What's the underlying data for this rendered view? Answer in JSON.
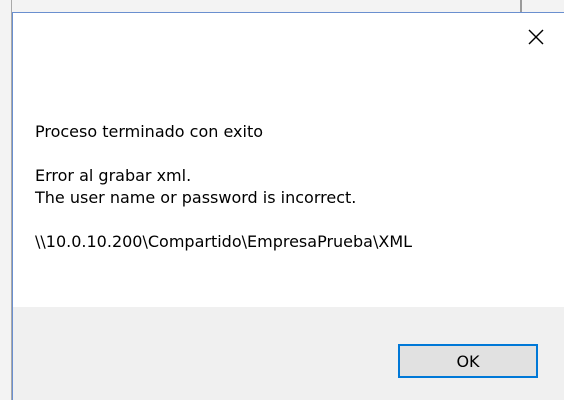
{
  "dialog": {
    "close_icon": "close-icon",
    "messages": {
      "line1": "Proceso terminado con exito",
      "line2": "Error al grabar xml.",
      "line3": "The user name or password is incorrect.",
      "line4": "\\\\10.0.10.200\\Compartido\\EmpresaPrueba\\XML"
    },
    "ok_label": "OK"
  },
  "colors": {
    "accent": "#0078d7",
    "footer_bg": "#f0f0f0",
    "button_bg": "#e1e1e1",
    "window_border": "#6a8fcf"
  }
}
